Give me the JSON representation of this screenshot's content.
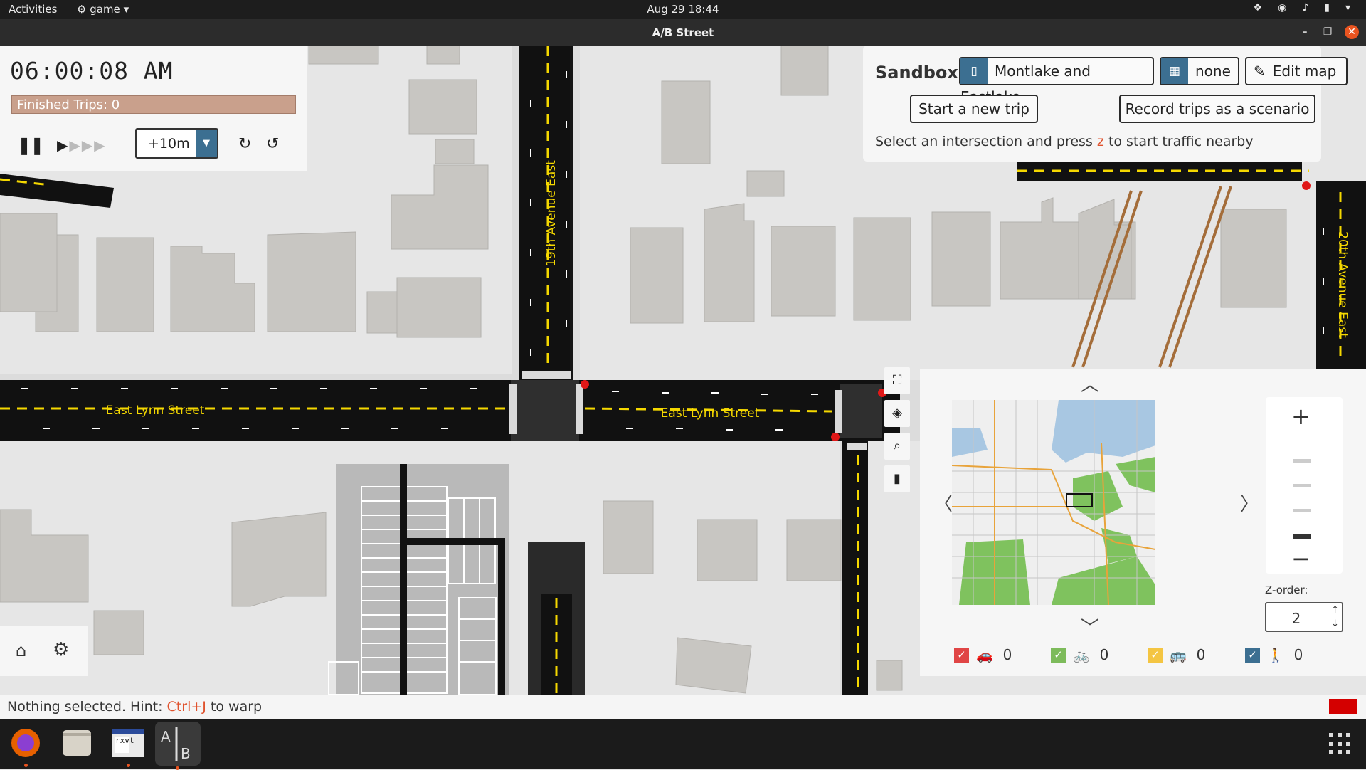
{
  "system": {
    "activities": "Activities",
    "app_menu": "game",
    "clock": "Aug 29  18:44"
  },
  "window": {
    "title": "A/B Street"
  },
  "time_panel": {
    "time": "06:00:08 AM",
    "finished_trips": "Finished Trips: 0",
    "step": "+10m"
  },
  "sandbox": {
    "title": "Sandbox",
    "map_name": "Montlake and Eastlake",
    "scenario": "none",
    "edit_map": "Edit map",
    "start_trip": "Start a new trip",
    "record_trips": "Record trips as a scenario",
    "hint_prefix": "Select an intersection and press",
    "hint_key": "z",
    "hint_suffix": "to start traffic nearby"
  },
  "streets": {
    "nineteenth": "19th Avenue East",
    "twentieth": "20th Avenue East",
    "lynn_left": "East Lynn Street",
    "lynn_right": "East Lynn Street"
  },
  "minimap": {
    "zorder_label": "Z-order:",
    "zorder_value": "2",
    "filters": [
      {
        "name": "car",
        "icon": "car-icon",
        "count": "0",
        "color": "#e04545"
      },
      {
        "name": "bike",
        "icon": "bike-icon",
        "count": "0",
        "color": "#7dbb5b"
      },
      {
        "name": "bus",
        "icon": "bus-icon",
        "count": "0",
        "color": "#f4c542"
      },
      {
        "name": "pedestrian",
        "icon": "pedestrian-icon",
        "count": "0",
        "color": "#3c6f91"
      }
    ]
  },
  "status": {
    "prefix": "Nothing selected. Hint:",
    "key": "Ctrl+J",
    "suffix": "to warp"
  },
  "dock": {
    "terminal_label": "rxvt"
  },
  "colors": {
    "accent": "#3c6f91",
    "road": "#111111",
    "lane_marking": "#f5d800",
    "building": "#c8c6c2",
    "finished_bar": "#c9a08c",
    "hint_key": "#e0522d"
  }
}
